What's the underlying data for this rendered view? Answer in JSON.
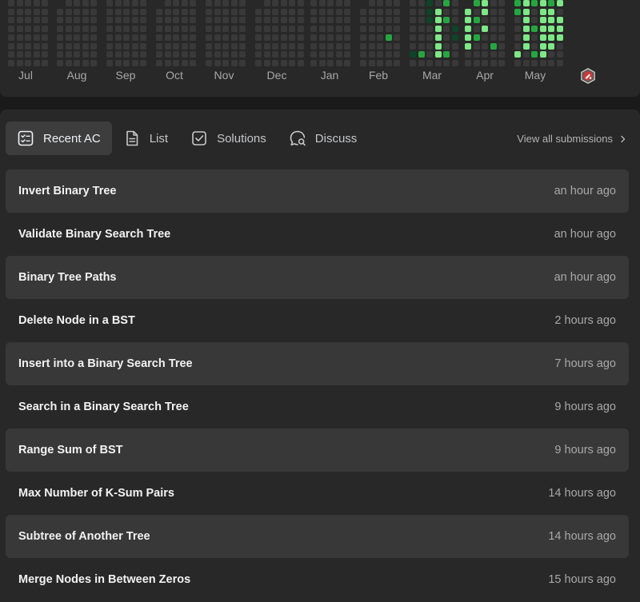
{
  "colors": {
    "background": "#1a1a1a",
    "card": "#282828",
    "row_alt": "#383838",
    "heat_empty": "#393939",
    "heat_low": "#0e4429",
    "heat_mid": "#26a641",
    "heat_high": "#7ee787",
    "muted_text": "#a8a8a8"
  },
  "heatmap": {
    "months": [
      "Jul",
      "Aug",
      "Sep",
      "Oct",
      "Nov",
      "Dec",
      "Jan",
      "Feb",
      "Mar",
      "Apr",
      "May"
    ],
    "badge_icon": "contest-badge-icon"
  },
  "tabs": [
    {
      "label": "Recent AC",
      "icon": "checklist-icon",
      "active": true
    },
    {
      "label": "List",
      "icon": "document-icon",
      "active": false
    },
    {
      "label": "Solutions",
      "icon": "checkbox-icon",
      "active": false
    },
    {
      "label": "Discuss",
      "icon": "chat-search-icon",
      "active": false
    }
  ],
  "view_all_label": "View all submissions",
  "submissions": [
    {
      "title": "Invert Binary Tree",
      "time": "an hour ago"
    },
    {
      "title": "Validate Binary Search Tree",
      "time": "an hour ago"
    },
    {
      "title": "Binary Tree Paths",
      "time": "an hour ago"
    },
    {
      "title": "Delete Node in a BST",
      "time": "2 hours ago"
    },
    {
      "title": "Insert into a Binary Search Tree",
      "time": "7 hours ago"
    },
    {
      "title": "Search in a Binary Search Tree",
      "time": "9 hours ago"
    },
    {
      "title": "Range Sum of BST",
      "time": "9 hours ago"
    },
    {
      "title": "Max Number of K-Sum Pairs",
      "time": "14 hours ago"
    },
    {
      "title": "Subtree of Another Tree",
      "time": "14 hours ago"
    },
    {
      "title": "Merge Nodes in Between Zeros",
      "time": "15 hours ago"
    }
  ]
}
